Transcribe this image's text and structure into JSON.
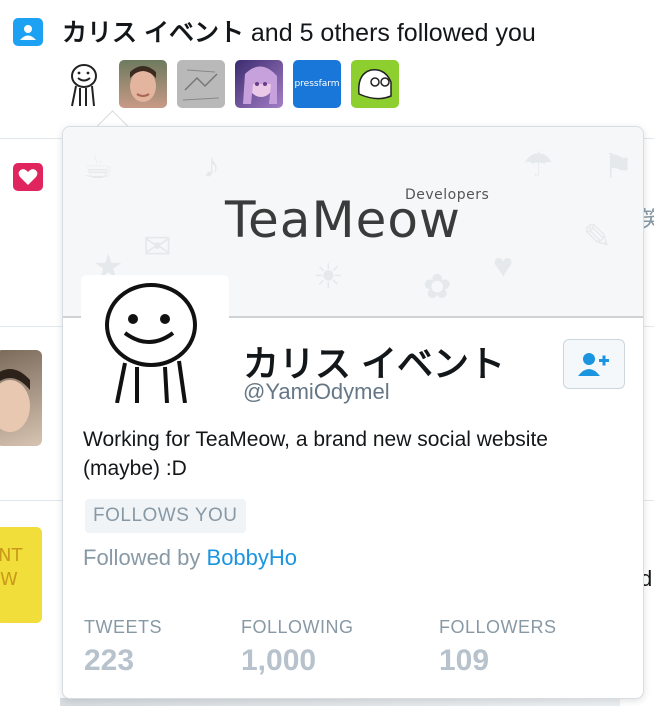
{
  "notification": {
    "title_name": "カリス イベント",
    "title_rest": "and 5 others followed you",
    "icon": "person-icon",
    "followers": [
      {
        "name": "カリス イベント avatar"
      },
      {
        "name": "user photo"
      },
      {
        "name": "sketch"
      },
      {
        "name": "anime"
      },
      {
        "name": "pressfarm"
      },
      {
        "name": "dog"
      }
    ],
    "pressfarm_label": "pressfarm"
  },
  "second_notification": {
    "icon": "heart-icon"
  },
  "card": {
    "banner_logo": "TeaMeow",
    "banner_logo_sub": "Developers",
    "name": "カリス イベント",
    "handle": "@YamiOdymel",
    "bio": "Working for TeaMeow, a brand new social website (maybe) :D",
    "follows_you": "FOLLOWS YOU",
    "followed_by_prefix": "Followed by",
    "followed_by_user": "BobbyHo",
    "stats": [
      {
        "label": "TWEETS",
        "value": "223"
      },
      {
        "label": "FOLLOWING",
        "value": "1,000"
      },
      {
        "label": "FOLLOWERS",
        "value": "109"
      }
    ]
  },
  "colors": {
    "accent": "#1b95e0",
    "heart": "#e0245e",
    "muted": "#8899a6",
    "stat_value": "#b7c2cc"
  }
}
